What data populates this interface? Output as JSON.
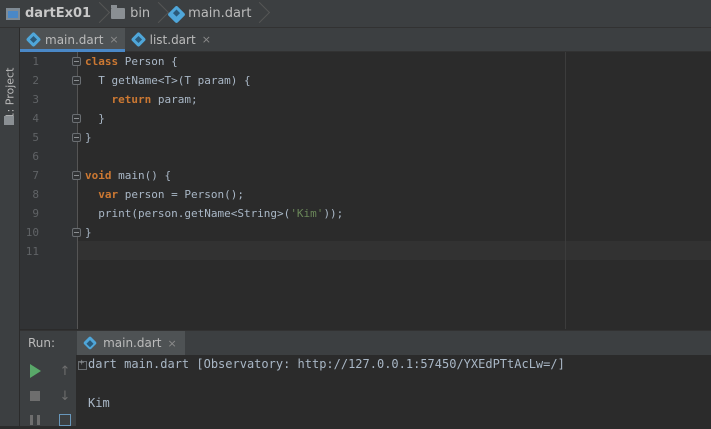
{
  "breadcrumb": [
    {
      "label": "dartEx01",
      "icon": "project-folder-icon"
    },
    {
      "label": "bin",
      "icon": "folder-icon"
    },
    {
      "label": "main.dart",
      "icon": "dart-file-icon"
    }
  ],
  "side_panel": {
    "project_tab": "1: Project"
  },
  "editor_tabs": [
    {
      "label": "main.dart",
      "active": true,
      "close": "×"
    },
    {
      "label": "list.dart",
      "active": false,
      "close": "×"
    }
  ],
  "editor": {
    "line_numbers": [
      "1",
      "2",
      "3",
      "4",
      "5",
      "6",
      "7",
      "8",
      "9",
      "10",
      "11"
    ],
    "lines": [
      [
        {
          "t": "class",
          "c": "kw"
        },
        {
          "t": " Person {",
          "c": ""
        }
      ],
      [
        {
          "t": "  T getName<T>(T param) {",
          "c": ""
        }
      ],
      [
        {
          "t": "    ",
          "c": ""
        },
        {
          "t": "return",
          "c": "kw"
        },
        {
          "t": " param;",
          "c": ""
        }
      ],
      [
        {
          "t": "  }",
          "c": ""
        }
      ],
      [
        {
          "t": "}",
          "c": ""
        }
      ],
      [
        {
          "t": "",
          "c": ""
        }
      ],
      [
        {
          "t": "void",
          "c": "kw"
        },
        {
          "t": " main() {",
          "c": ""
        }
      ],
      [
        {
          "t": "  ",
          "c": ""
        },
        {
          "t": "var",
          "c": "kw"
        },
        {
          "t": " person = Person();",
          "c": ""
        }
      ],
      [
        {
          "t": "  print(person.getName<String>(",
          "c": ""
        },
        {
          "t": "'Kim'",
          "c": "str"
        },
        {
          "t": "));",
          "c": ""
        }
      ],
      [
        {
          "t": "}",
          "c": ""
        }
      ],
      [
        {
          "t": "",
          "c": ""
        }
      ]
    ]
  },
  "run_panel": {
    "label": "Run:",
    "tab_label": "main.dart",
    "tab_close": "×",
    "console": [
      "dart main.dart [Observatory: http://127.0.0.1:57450/YXEdPTtAcLw=/]",
      "",
      "Kim"
    ]
  },
  "colors": {
    "keyword": "#cc7832",
    "string": "#6a8759",
    "accent": "#4a88c7",
    "run_green": "#59a869"
  }
}
